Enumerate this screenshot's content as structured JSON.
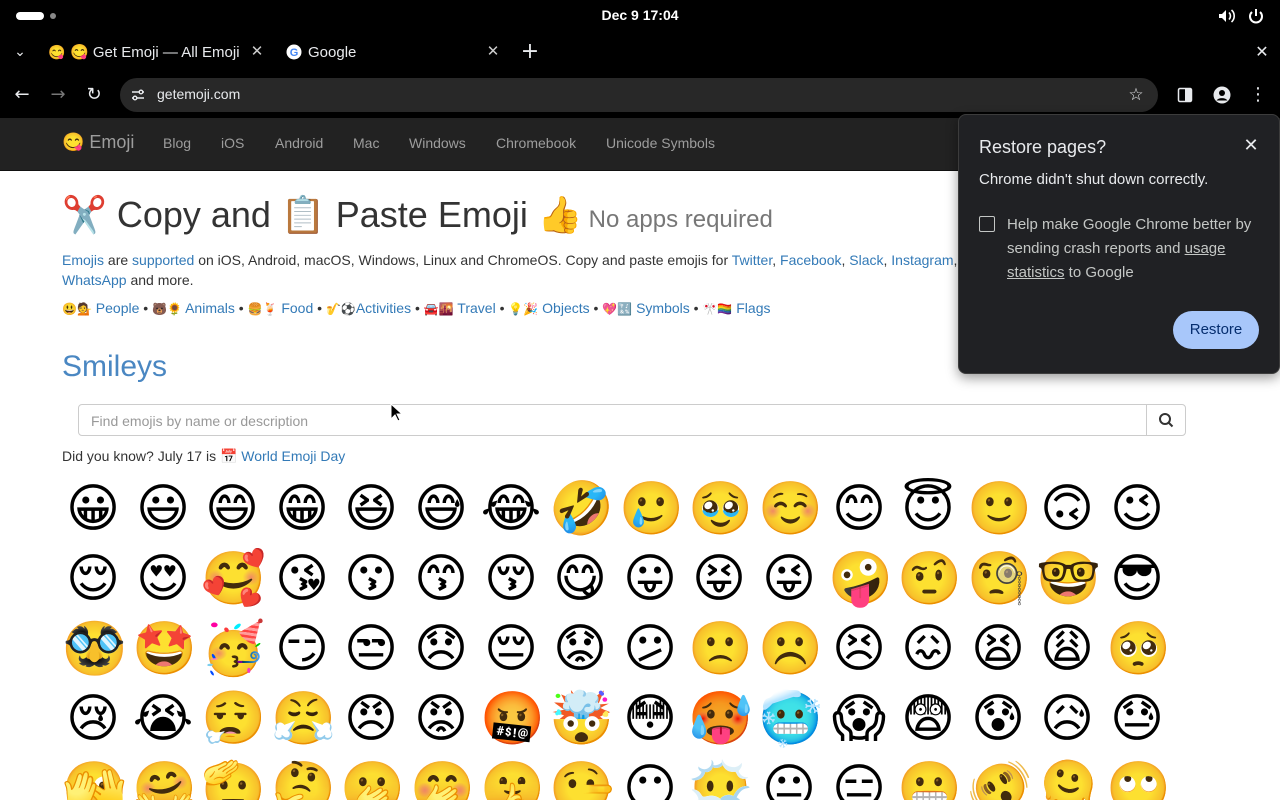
{
  "system": {
    "time": "Dec 9  17:04"
  },
  "tabs": [
    {
      "favicon": "😋",
      "label": "😋 Get Emoji — All Emoji"
    },
    {
      "favicon": "G",
      "label": "Google"
    }
  ],
  "address": {
    "url": "getemoji.com"
  },
  "site_nav": {
    "brand": "😋 Emoji",
    "links": [
      "Blog",
      "iOS",
      "Android",
      "Mac",
      "Windows",
      "Chromebook",
      "Unicode Symbols"
    ]
  },
  "page": {
    "headline_pre": "✂️ Copy and 📋 Paste Emoji 👍",
    "headline_small": "No apps required",
    "lead": {
      "link_emojis": "Emojis",
      "are": " are ",
      "link_supported": "supported",
      "rest1": " on iOS, Android, macOS, Windows, Linux and ChromeOS. Copy and paste emojis for ",
      "link_twitter": "Twitter",
      "link_facebook": "Facebook",
      "link_slack": "Slack",
      "link_instagram": "Instagram",
      "link_whatsapp": "WhatsApp",
      "rest2": " and more."
    },
    "categories": [
      {
        "icons": "😃💁",
        "label": "People"
      },
      {
        "icons": "🐻🌻",
        "label": "Animals"
      },
      {
        "icons": "🍔🍹",
        "label": "Food"
      },
      {
        "icons": "🎷⚽",
        "label": "Activities"
      },
      {
        "icons": "🚘🌇",
        "label": "Travel"
      },
      {
        "icons": "💡🎉",
        "label": "Objects"
      },
      {
        "icons": "💖🔣",
        "label": "Symbols"
      },
      {
        "icons": "🎌🏳️‍🌈",
        "label": "Flags"
      }
    ],
    "section_title": "Smileys",
    "search_placeholder": "Find emojis by name or description",
    "did_you_know": "Did you know? July 17 is 📅 ",
    "did_you_know_link": "World Emoji Day",
    "emojis": [
      "😀",
      "😃",
      "😄",
      "😁",
      "😆",
      "😅",
      "😂",
      "🤣",
      "🥲",
      "🥹",
      "☺️",
      "😊",
      "😇",
      "🙂",
      "🙃",
      "😉",
      "😌",
      "😍",
      "🥰",
      "😘",
      "😗",
      "😙",
      "😚",
      "😋",
      "😛",
      "😝",
      "😜",
      "🤪",
      "🤨",
      "🧐",
      "🤓",
      "😎",
      "🥸",
      "🤩",
      "🥳",
      "😏",
      "😒",
      "😞",
      "😔",
      "😟",
      "😕",
      "🙁",
      "☹️",
      "😣",
      "😖",
      "😫",
      "😩",
      "🥺",
      "😢",
      "😭",
      "😮‍💨",
      "😤",
      "😠",
      "😡",
      "🤬",
      "🤯",
      "😳",
      "🥵",
      "🥶",
      "😱",
      "😨",
      "😰",
      "😥",
      "😓",
      "🫣",
      "🤗",
      "🫡",
      "🤔",
      "🫢",
      "🤭",
      "🤫",
      "🤥",
      "😶",
      "😶‍🌫️",
      "😐",
      "😑",
      "😬",
      "🫨",
      "🫠",
      "🙄"
    ]
  },
  "dialog": {
    "title": "Restore pages?",
    "message": "Chrome didn't shut down correctly.",
    "checkbox_text": "Help make Google Chrome better by sending crash reports and ",
    "checkbox_link": "usage statistics",
    "checkbox_tail": " to Google",
    "restore_label": "Restore"
  }
}
